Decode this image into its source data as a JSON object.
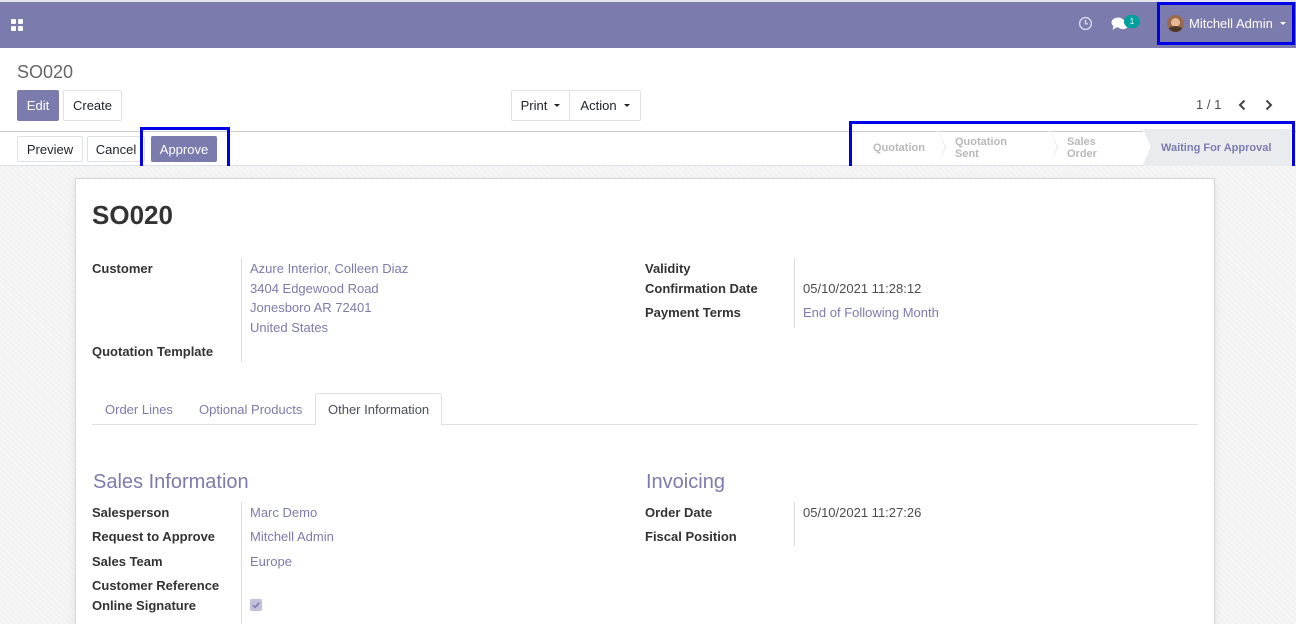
{
  "navbar": {
    "apps_icon": "apps-grid-icon",
    "activity_icon": "clock-icon",
    "messaging_icon": "chat-icon",
    "message_count": "1",
    "user_name": "Mitchell Admin"
  },
  "control_panel": {
    "breadcrumb": "SO020",
    "edit_label": "Edit",
    "create_label": "Create",
    "print_label": "Print",
    "action_label": "Action",
    "pager": "1 / 1"
  },
  "header": {
    "preview_label": "Preview",
    "cancel_label": "Cancel",
    "approve_label": "Approve",
    "stages": [
      "Quotation",
      "Quotation Sent",
      "Sales Order",
      "Waiting For Approval"
    ],
    "active_stage": "Waiting For Approval"
  },
  "form": {
    "title": "SO020",
    "customer_label": "Customer",
    "customer_name": "Azure Interior, Colleen Diaz",
    "customer_street": "3404 Edgewood Road",
    "customer_city": "Jonesboro AR 72401",
    "customer_country": "United States",
    "quotation_template_label": "Quotation Template",
    "validity_label": "Validity",
    "confirmation_date_label": "Confirmation Date",
    "confirmation_date": "05/10/2021 11:28:12",
    "payment_terms_label": "Payment Terms",
    "payment_terms": "End of Following Month"
  },
  "tabs": [
    "Order Lines",
    "Optional Products",
    "Other Information"
  ],
  "active_tab": "Other Information",
  "sales_information": {
    "title": "Sales Information",
    "salesperson_label": "Salesperson",
    "salesperson": "Marc Demo",
    "request_label": "Request to Approve",
    "request": "Mitchell Admin",
    "sales_team_label": "Sales Team",
    "sales_team": "Europe",
    "customer_reference_label": "Customer Reference",
    "online_signature_label": "Online Signature",
    "online_signature": true
  },
  "invoicing": {
    "title": "Invoicing",
    "order_date_label": "Order Date",
    "order_date": "05/10/2021 11:27:26",
    "fiscal_position_label": "Fiscal Position"
  },
  "colors": {
    "brand": "#7c7bad",
    "highlight": "#0000e6",
    "badge": "#00a09d"
  }
}
